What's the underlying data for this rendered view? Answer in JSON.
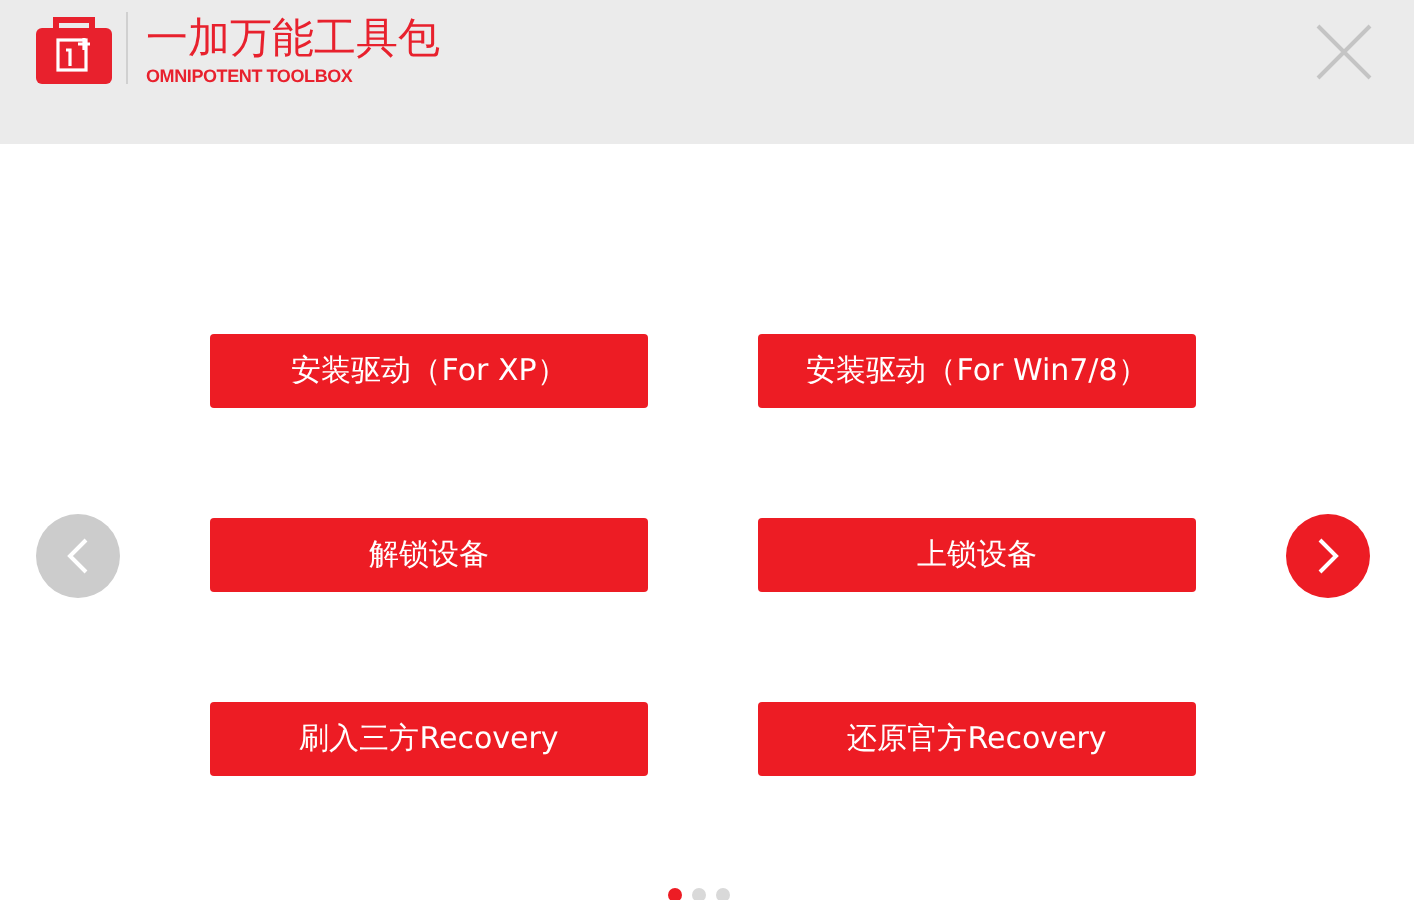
{
  "header": {
    "title": "一加万能工具包",
    "subtitle": "OMNIPOTENT TOOLBOX"
  },
  "actions": [
    {
      "label": "安装驱动（For XP）"
    },
    {
      "label": "安装驱动（For Win7/8）"
    },
    {
      "label": "解锁设备"
    },
    {
      "label": "上锁设备"
    },
    {
      "label": "刷入三方Recovery"
    },
    {
      "label": "还原官方Recovery"
    }
  ],
  "pager": {
    "prev_disabled": true,
    "next_disabled": false,
    "pages": [
      {
        "selected": true
      },
      {
        "selected": false
      },
      {
        "selected": false
      }
    ]
  }
}
